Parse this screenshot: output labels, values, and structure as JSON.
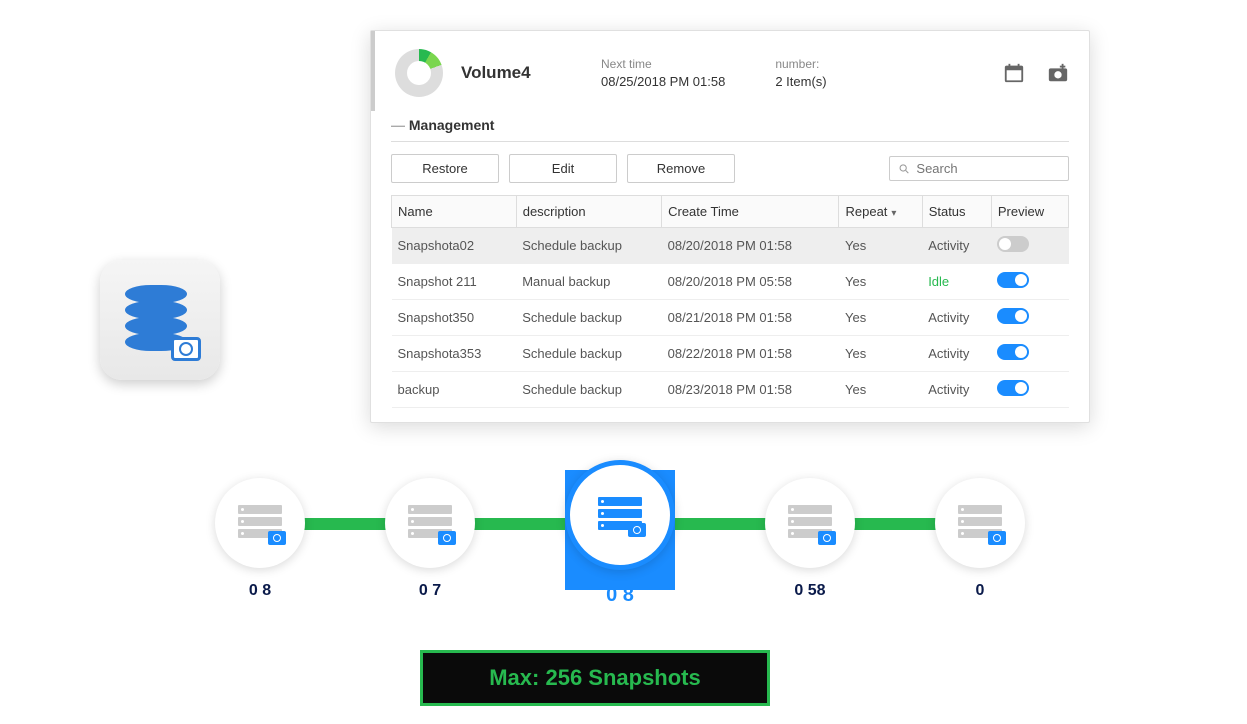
{
  "volume": {
    "name": "Volume4",
    "next_time_label": "Next time",
    "next_time": "08/25/2018 PM 01:58",
    "number_label": "number:",
    "number": "2 Item(s)"
  },
  "management": {
    "title": "Management",
    "buttons": {
      "restore": "Restore",
      "edit": "Edit",
      "remove": "Remove"
    },
    "search_placeholder": "Search",
    "columns": {
      "name": "Name",
      "description": "description",
      "create": "Create Time",
      "repeat": "Repeat",
      "status": "Status",
      "preview": "Preview"
    },
    "rows": [
      {
        "name": "Snapshota02",
        "desc": "Schedule backup",
        "time": "08/20/2018 PM 01:58",
        "repeat": "Yes",
        "status": "Activity",
        "on": false,
        "selected": true
      },
      {
        "name": "Snapshot 211",
        "desc": "Manual backup",
        "time": "08/20/2018 PM 05:58",
        "repeat": "Yes",
        "status": "Idle",
        "on": true,
        "idle": true
      },
      {
        "name": "Snapshot350",
        "desc": "Schedule backup",
        "time": "08/21/2018 PM 01:58",
        "repeat": "Yes",
        "status": "Activity",
        "on": true
      },
      {
        "name": "Snapshota353",
        "desc": "Schedule backup",
        "time": "08/22/2018 PM 01:58",
        "repeat": "Yes",
        "status": "Activity",
        "on": true
      },
      {
        "name": "backup",
        "desc": "Schedule backup",
        "time": "08/23/2018 PM 01:58",
        "repeat": "Yes",
        "status": "Activity",
        "on": true
      }
    ]
  },
  "timeline": [
    {
      "label": "0                8"
    },
    {
      "label": "0                7"
    },
    {
      "label": "0                    8",
      "big": true
    },
    {
      "label": "0                58"
    },
    {
      "label": "0                "
    }
  ],
  "max_label": "Max: 256 Snapshots"
}
